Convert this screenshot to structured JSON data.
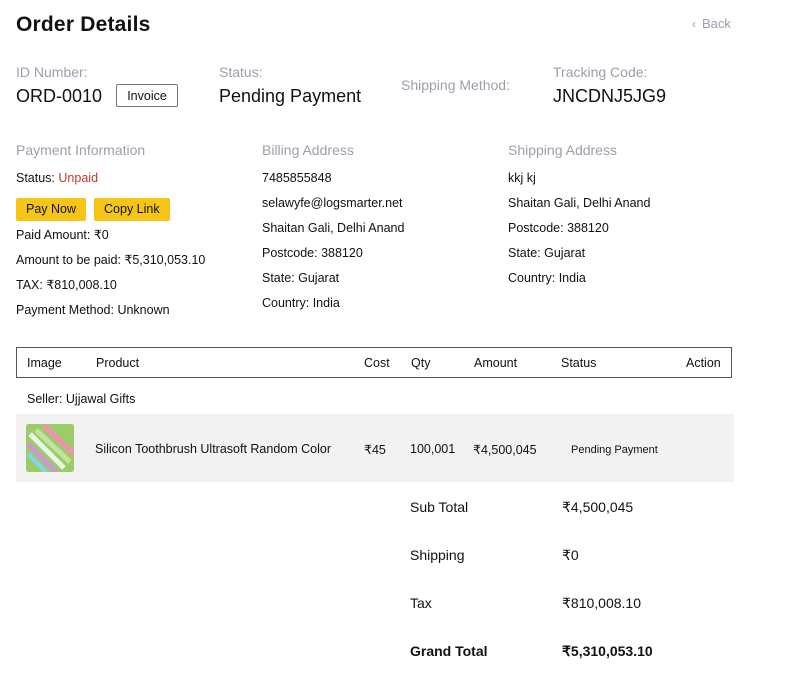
{
  "header": {
    "title": "Order Details",
    "back_label": "Back"
  },
  "summary": {
    "id_label": "ID Number:",
    "id_value": "ORD-0010",
    "invoice_button": "Invoice",
    "status_label": "Status:",
    "status_value": "Pending Payment",
    "shipping_method_label": "Shipping Method:",
    "tracking_label": "Tracking Code:",
    "tracking_value": "JNCDNJ5JG9"
  },
  "payment": {
    "heading": "Payment Information",
    "status_label": "Status:",
    "status_value": "Unpaid",
    "pay_now_button": "Pay Now",
    "copy_link_button": "Copy Link",
    "paid_amount": "Paid Amount: ₹0",
    "amount_to_be_paid": "Amount to be paid: ₹5,310,053.10",
    "tax": "TAX: ₹810,008.10",
    "method": "Payment Method: Unknown"
  },
  "billing": {
    "heading": "Billing Address",
    "phone": "7485855848",
    "email": "selawyfe@logsmarter.net",
    "address": "Shaitan Gali, Delhi Anand",
    "postcode": "Postcode: 388120",
    "state": "State: Gujarat",
    "country": "Country: India"
  },
  "shipping": {
    "heading": "Shipping Address",
    "name": "kkj kj",
    "address": "Shaitan Gali, Delhi Anand",
    "postcode": "Postcode: 388120",
    "state": "State: Gujarat",
    "country": "Country: India"
  },
  "table": {
    "headers": {
      "image": "Image",
      "product": "Product",
      "cost": "Cost",
      "qty": "Qty",
      "amount": "Amount",
      "status": "Status",
      "action": "Action"
    },
    "seller": "Seller: Ujjawal Gifts",
    "rows": [
      {
        "product": "Silicon Toothbrush Ultrasoft Random Color",
        "cost": "₹45",
        "qty": "100,001",
        "amount": "₹4,500,045",
        "status": "Pending Payment",
        "image_icon": "toothbrush-product-image"
      }
    ]
  },
  "totals": {
    "subtotal_label": "Sub Total",
    "subtotal_value": "₹4,500,045",
    "shipping_label": "Shipping",
    "shipping_value": "₹0",
    "tax_label": "Tax",
    "tax_value": "₹810,008.10",
    "grand_label": "Grand Total",
    "grand_value": "₹5,310,053.10"
  },
  "colors": {
    "accent_yellow": "#f5c518",
    "unpaid_red": "#c0392b",
    "muted_label": "#9aa0aa",
    "row_bg": "#f2f2f2"
  }
}
